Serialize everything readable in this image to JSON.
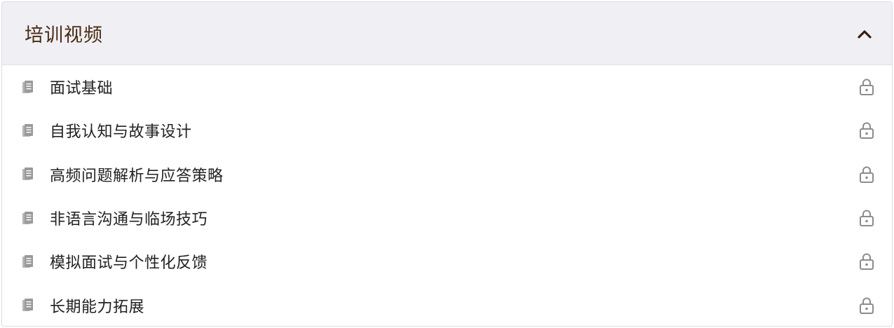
{
  "panel": {
    "title": "培训视频",
    "expanded": true,
    "collapse_icon": "chevron-up-icon"
  },
  "items": [
    {
      "label": "面试基础",
      "icon": "document-icon",
      "status_icon": "lock-icon",
      "locked": true
    },
    {
      "label": "自我认知与故事设计",
      "icon": "document-icon",
      "status_icon": "lock-icon",
      "locked": true
    },
    {
      "label": "高频问题解析与应答策略",
      "icon": "document-icon",
      "status_icon": "lock-icon",
      "locked": true
    },
    {
      "label": "非语言沟通与临场技巧",
      "icon": "document-icon",
      "status_icon": "lock-icon",
      "locked": true
    },
    {
      "label": "模拟面试与个性化反馈",
      "icon": "document-icon",
      "status_icon": "lock-icon",
      "locked": true
    },
    {
      "label": "长期能力拓展",
      "icon": "document-icon",
      "status_icon": "lock-icon",
      "locked": true
    }
  ],
  "colors": {
    "header_bg": "#f0f0f4",
    "title": "#4a2a12",
    "icon_gray": "#9a9a9a",
    "lock_gray": "#8c8c8c"
  }
}
